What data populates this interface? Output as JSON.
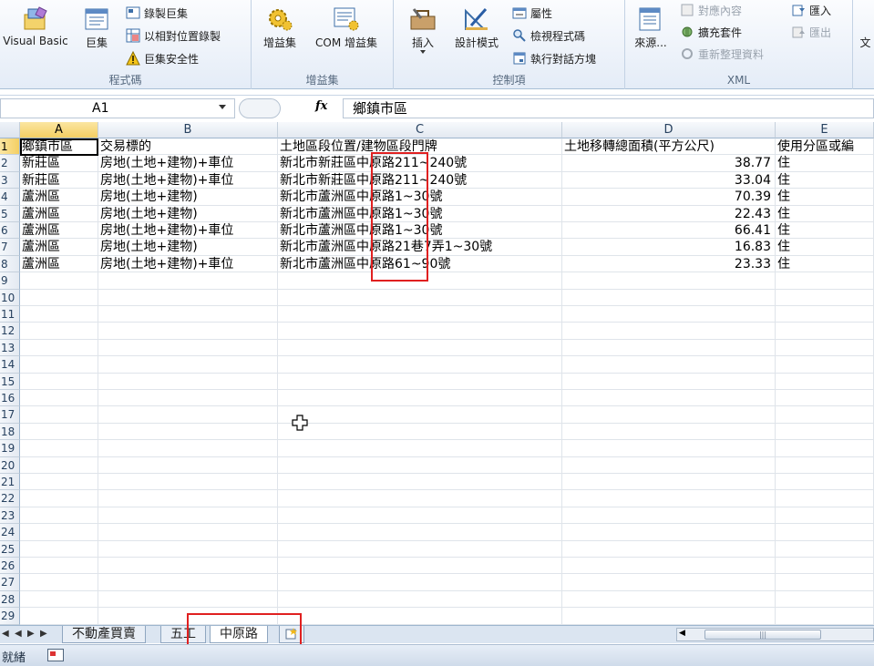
{
  "ribbon": {
    "groups": [
      {
        "label": "程式碼"
      },
      {
        "label": "增益集"
      },
      {
        "label": "控制項"
      },
      {
        "label": "XML"
      }
    ],
    "code": {
      "visual_basic": "Visual Basic",
      "macros": "巨集",
      "record_macro": "錄製巨集",
      "relative_ref": "以相對位置錄製",
      "macro_security": "巨集安全性"
    },
    "addins": {
      "addins": "增益集",
      "com_addins": "COM 增益集"
    },
    "controls": {
      "insert": "插入",
      "design_mode": "設計模式",
      "properties": "屬性",
      "view_code": "檢視程式碼",
      "run_dialog": "執行對話方塊"
    },
    "xml": {
      "source": "來源...",
      "map_properties": "對應內容",
      "expansion_packs": "擴充套件",
      "refresh_data": "重新整理資料",
      "import": "匯入",
      "export": "匯出"
    },
    "overflow": "文"
  },
  "formula_bar": {
    "name_box": "A1",
    "fx": "fx",
    "content": "鄉鎮市區"
  },
  "grid": {
    "columns": [
      "A",
      "B",
      "C",
      "D",
      "E"
    ],
    "row_numbers": [
      "1",
      "2",
      "3",
      "4",
      "5",
      "6",
      "7",
      "8",
      "9",
      "10",
      "11",
      "12",
      "13",
      "14",
      "15",
      "16",
      "17",
      "18",
      "19",
      "20",
      "21",
      "22",
      "23",
      "24",
      "25",
      "26",
      "27",
      "28",
      "29"
    ],
    "header": [
      "鄉鎮市區",
      "交易標的",
      "土地區段位置/建物區段門牌",
      "土地移轉總面積(平方公尺)",
      "使用分區或編"
    ],
    "rows": [
      [
        "新莊區",
        "房地(土地+建物)+車位",
        "新北市新莊區中原路211~240號",
        "38.77",
        "住"
      ],
      [
        "新莊區",
        "房地(土地+建物)+車位",
        "新北市新莊區中原路211~240號",
        "33.04",
        "住"
      ],
      [
        "蘆洲區",
        "房地(土地+建物)",
        "新北市蘆洲區中原路1~30號",
        "70.39",
        "住"
      ],
      [
        "蘆洲區",
        "房地(土地+建物)",
        "新北市蘆洲區中原路1~30號",
        "22.43",
        "住"
      ],
      [
        "蘆洲區",
        "房地(土地+建物)+車位",
        "新北市蘆洲區中原路1~30號",
        "66.41",
        "住"
      ],
      [
        "蘆洲區",
        "房地(土地+建物)",
        "新北市蘆洲區中原路21巷7弄1~30號",
        "16.83",
        "住"
      ],
      [
        "蘆洲區",
        "房地(土地+建物)+車位",
        "新北市蘆洲區中原路61~90號",
        "23.33",
        "住"
      ]
    ]
  },
  "sheet_tabs": [
    {
      "label": "不動產買賣"
    },
    {
      "label": "五工"
    },
    {
      "label": "中原路",
      "active": true
    }
  ],
  "status": {
    "text": "就緒"
  }
}
